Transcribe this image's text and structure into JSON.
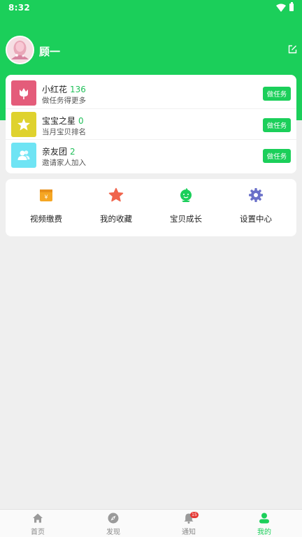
{
  "status_bar": {
    "time": "8:32"
  },
  "profile": {
    "name": "顾一"
  },
  "tasks": [
    {
      "name": "小红花",
      "count": "136",
      "desc": "做任务得更多",
      "button": "做任务",
      "color": "#e45c7a",
      "icon": "flower-icon"
    },
    {
      "name": "宝宝之星",
      "count": "0",
      "desc": "当月宝贝排名",
      "button": "做任务",
      "color": "#dfd22e",
      "icon": "star-icon"
    },
    {
      "name": "亲友团",
      "count": "2",
      "desc": "邀请家人加入",
      "button": "做任务",
      "color": "#6fe4f4",
      "icon": "people-icon"
    }
  ],
  "menu": [
    {
      "label": "视频缴费",
      "icon": "wallet-icon",
      "color": "#f5a623"
    },
    {
      "label": "我的收藏",
      "icon": "star-icon",
      "color": "#f0644c"
    },
    {
      "label": "宝贝成长",
      "icon": "baby-icon",
      "color": "#1bcf5a"
    },
    {
      "label": "设置中心",
      "icon": "gear-icon",
      "color": "#6a70c9"
    }
  ],
  "tabbar": {
    "items": [
      {
        "label": "首页",
        "icon": "home-icon"
      },
      {
        "label": "发现",
        "icon": "compass-icon"
      },
      {
        "label": "通知",
        "icon": "bell-icon",
        "badge": "15"
      },
      {
        "label": "我的",
        "icon": "user-icon",
        "active": true
      }
    ]
  },
  "colors": {
    "brand": "#1bcf5a",
    "background": "#efefef"
  }
}
